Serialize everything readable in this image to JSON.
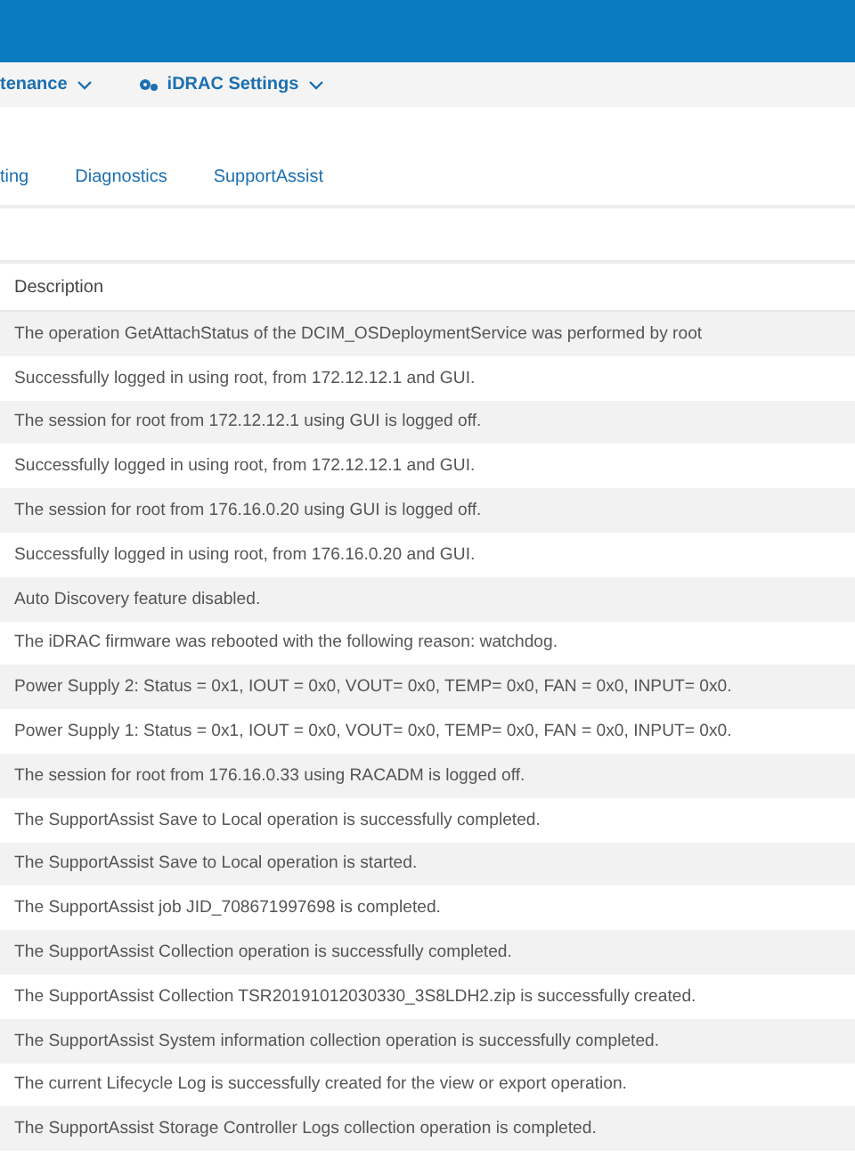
{
  "nav": {
    "items": [
      {
        "label": "tenance",
        "kind": "plain"
      },
      {
        "label": "iDRAC Settings",
        "kind": "settings"
      }
    ]
  },
  "tabs": [
    {
      "label": "ting",
      "selected": false
    },
    {
      "label": "Diagnostics",
      "selected": false
    },
    {
      "label": "SupportAssist",
      "selected": false
    }
  ],
  "table": {
    "columns": [
      "Description"
    ],
    "rows": [
      "The operation GetAttachStatus of the DCIM_OSDeploymentService was performed by root",
      "Successfully logged in using root, from 172.12.12.1 and GUI.",
      "The session for root from 172.12.12.1 using GUI is logged off.",
      "Successfully logged in using root, from 172.12.12.1 and GUI.",
      "The session for root from 176.16.0.20 using GUI is logged off.",
      "Successfully logged in using root, from 176.16.0.20 and GUI.",
      "Auto Discovery feature disabled.",
      "The iDRAC firmware was rebooted with the following reason: watchdog.",
      "Power Supply 2: Status = 0x1, IOUT = 0x0, VOUT= 0x0, TEMP= 0x0, FAN = 0x0, INPUT= 0x0.",
      "Power Supply 1: Status = 0x1, IOUT = 0x0, VOUT= 0x0, TEMP= 0x0, FAN = 0x0, INPUT= 0x0.",
      "The session for root from 176.16.0.33 using RACADM is logged off.",
      "The SupportAssist Save to Local operation is successfully completed.",
      "The SupportAssist Save to Local operation is started.",
      "The SupportAssist job JID_708671997698 is completed.",
      "The SupportAssist Collection operation is successfully completed.",
      "The SupportAssist Collection TSR20191012030330_3S8LDH2.zip is successfully created.",
      "The SupportAssist System information collection operation is successfully completed.",
      "The current Lifecycle Log is successfully created for the view or export operation.",
      "The SupportAssist Storage Controller Logs collection operation is completed."
    ]
  }
}
